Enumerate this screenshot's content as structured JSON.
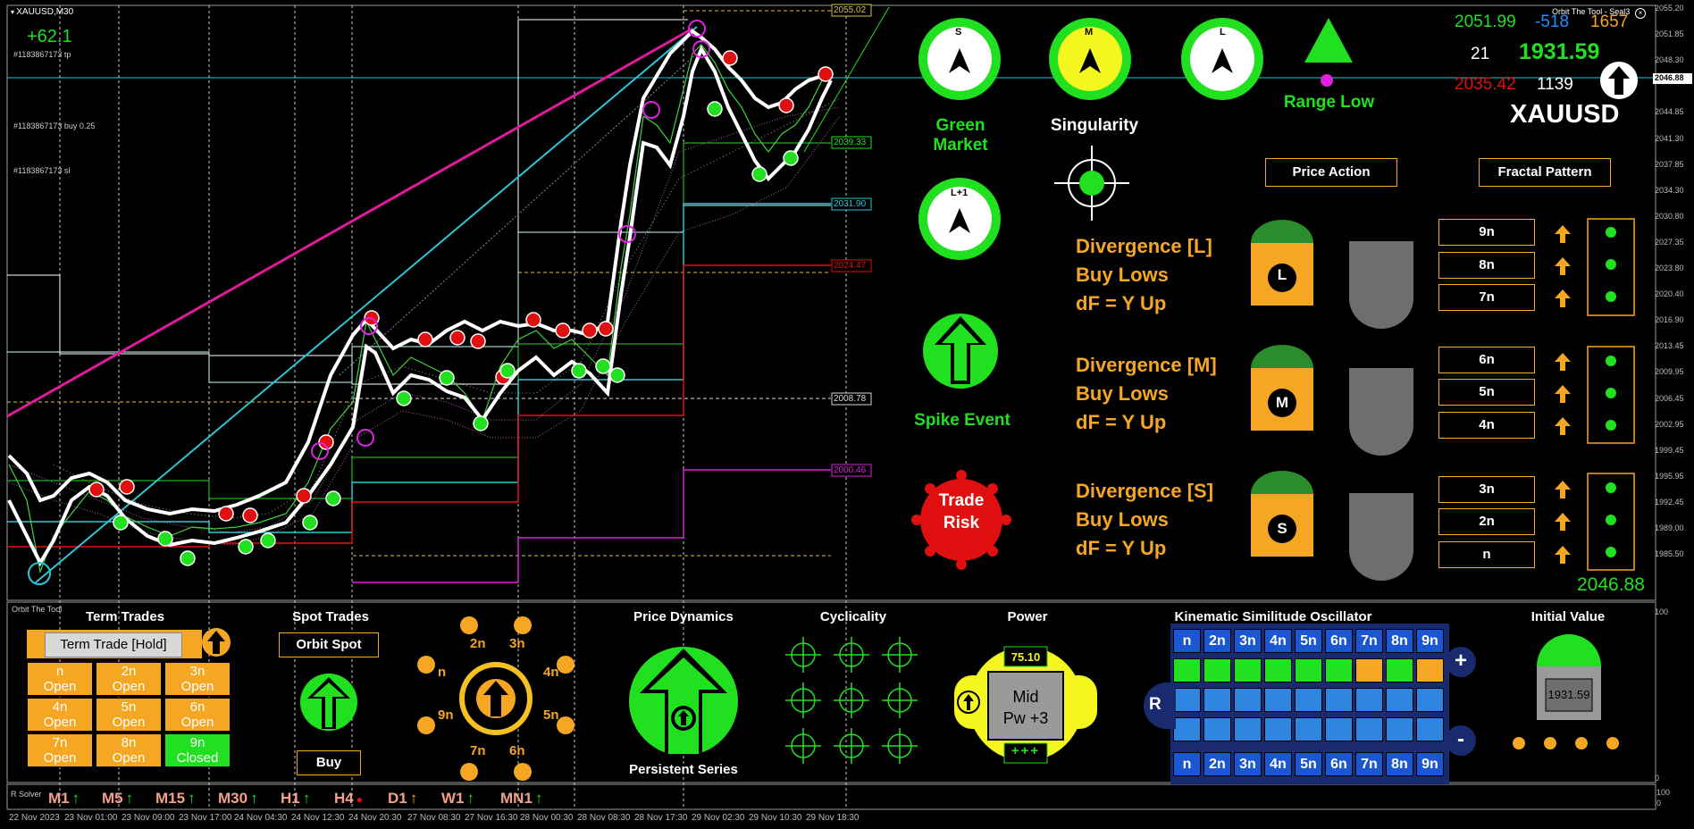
{
  "window": {
    "symbol_title": "XAUUSD,M30",
    "indicator_title": "Orbit The Tool - Seal3"
  },
  "chart_left": {
    "pnl": "+62.1",
    "order_tp": "#1183867173 tp",
    "order_buy": "#1183867173 buy 0.25",
    "order_sl": "#1183867173 sl",
    "level_tags": [
      "2055.02",
      "2039.33",
      "2031.90",
      "2024.47",
      "2008.78",
      "2000.46"
    ]
  },
  "stats": {
    "high": "2051.99",
    "diff_neg": "-518",
    "count1": "1657",
    "n21": "21",
    "price": "1931.59",
    "low": "2035.42",
    "count2": "1139",
    "symbol": "XAUUSD"
  },
  "dials": {
    "s": "S",
    "m": "M",
    "l": "L",
    "l1": "L+1"
  },
  "labels": {
    "green_market": "Green Market",
    "singularity": "Singularity",
    "range_low": "Range Low",
    "spike_event": "Spike Event",
    "trade_risk_1": "Trade",
    "trade_risk_2": "Risk"
  },
  "buttons": {
    "price_action": "Price Action",
    "fractal_pattern": "Fractal Pattern"
  },
  "divergence": [
    {
      "title": "Divergence [L]",
      "l2": "Buy Lows",
      "l3": "dF = Y Up",
      "badge": "L",
      "levels": [
        "9n",
        "8n",
        "7n"
      ]
    },
    {
      "title": "Divergence [M]",
      "l2": "Buy Lows",
      "l3": "dF = Y Up",
      "badge": "M",
      "levels": [
        "6n",
        "5n",
        "4n"
      ]
    },
    {
      "title": "Divergence [S]",
      "l2": "Buy Lows",
      "l3": "dF = Y Up",
      "badge": "S",
      "levels": [
        "3n",
        "2n",
        "n"
      ]
    }
  ],
  "current_price": "2046.88",
  "price_axis": [
    "2055.20",
    "2051.85",
    "2048.30",
    "2046.88",
    "2044.85",
    "2041.30",
    "2037.85",
    "2034.30",
    "2030.80",
    "2027.35",
    "2023.80",
    "2020.40",
    "2016.90",
    "2013.45",
    "2009.95",
    "2006.45",
    "2002.95",
    "1999.45",
    "1995.95",
    "1992.45",
    "1989.00",
    "1985.50"
  ],
  "bottom": {
    "panel_label": "Orbit The Tool",
    "term_trades": {
      "title": "Term Trades",
      "button": "Term Trade [Hold]",
      "cells": [
        {
          "l1": "n",
          "l2": "Open"
        },
        {
          "l1": "4n",
          "l2": "Open"
        },
        {
          "l1": "7n",
          "l2": "Open"
        },
        {
          "l1": "2n",
          "l2": "Open"
        },
        {
          "l1": "5n",
          "l2": "Open"
        },
        {
          "l1": "8n",
          "l2": "Open"
        },
        {
          "l1": "3n",
          "l2": "Open"
        },
        {
          "l1": "6n",
          "l2": "Open"
        },
        {
          "l1": "9n",
          "l2": "Closed"
        }
      ]
    },
    "spot_trades": {
      "title": "Spot Trades",
      "button": "Orbit Spot",
      "action": "Buy"
    },
    "orbit_labels": [
      "2n",
      "3n",
      "4n",
      "5n",
      "6n",
      "7n",
      "9n",
      "n"
    ],
    "price_dynamics": {
      "title": "Price Dynamics",
      "caption": "Persistent Series"
    },
    "cyclicality": {
      "title": "Cyclicality"
    },
    "power": {
      "title": "Power",
      "value": "75.10",
      "mid1": "Mid",
      "mid2": "Pw +3",
      "plus": "+++"
    },
    "kso": {
      "title": "Kinematic Similitude Oscillator",
      "headers": [
        "n",
        "2n",
        "3n",
        "4n",
        "5n",
        "6n",
        "7n",
        "8n",
        "9n"
      ],
      "r": "R",
      "plus": "+",
      "minus": "-"
    },
    "initial_value": {
      "title": "Initial Value",
      "value": "1931.59"
    },
    "oscillator_axis": [
      "100",
      "0"
    ]
  },
  "timeframes": [
    {
      "label": "M1",
      "state": "up"
    },
    {
      "label": "M5",
      "state": "up"
    },
    {
      "label": "M15",
      "state": "up"
    },
    {
      "label": "M30",
      "state": "up"
    },
    {
      "label": "H1",
      "state": "up"
    },
    {
      "label": "H4",
      "state": "dot"
    },
    {
      "label": "D1",
      "state": "uporange"
    },
    {
      "label": "W1",
      "state": "up"
    },
    {
      "label": "MN1",
      "state": "up"
    }
  ],
  "solver_label": "R Solver",
  "time_axis": [
    "22 Nov 2023",
    "23 Nov 01:00",
    "23 Nov 09:00",
    "23 Nov 17:00",
    "24 Nov 04:30",
    "24 Nov 12:30",
    "24 Nov 20:30",
    "27 Nov 08:30",
    "27 Nov 16:30",
    "28 Nov 00:30",
    "28 Nov 08:30",
    "28 Nov 17:30",
    "29 Nov 02:30",
    "29 Nov 10:30",
    "29 Nov 18:30"
  ]
}
